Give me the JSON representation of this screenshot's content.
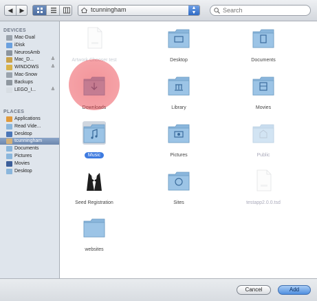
{
  "toolbar": {
    "back_glyph": "◀",
    "forward_glyph": "▶",
    "location": "tcunningham",
    "search_placeholder": "Search"
  },
  "sidebar": {
    "devices_header": "DEVICES",
    "places_header": "PLACES",
    "devices": [
      {
        "label": "Mac-Dual",
        "icon": "hard-drive-icon",
        "eject": false
      },
      {
        "label": "iDisk",
        "icon": "idisk-icon",
        "eject": false
      },
      {
        "label": "NeurosAmb",
        "icon": "network-drive-icon",
        "eject": false
      },
      {
        "label": "Mac_D...",
        "icon": "drive-icon",
        "eject": true
      },
      {
        "label": "WINDOWS",
        "icon": "windows-drive-icon",
        "eject": true
      },
      {
        "label": "Mac-Snow",
        "icon": "hard-drive-icon",
        "eject": false
      },
      {
        "label": "Backups",
        "icon": "backup-drive-icon",
        "eject": false
      },
      {
        "label": "LEGO_I...",
        "icon": "disc-icon",
        "eject": true
      }
    ],
    "places": [
      {
        "label": "Applications",
        "icon": "applications-icon"
      },
      {
        "label": "Read Vide...",
        "icon": "folder-icon"
      },
      {
        "label": "Desktop",
        "icon": "desktop-icon"
      },
      {
        "label": "tcunningham",
        "icon": "home-icon",
        "selected": true
      },
      {
        "label": "Documents",
        "icon": "documents-icon"
      },
      {
        "label": "Pictures",
        "icon": "pictures-icon"
      },
      {
        "label": "Movies",
        "icon": "movies-icon"
      },
      {
        "label": "Desktop",
        "icon": "desktop-folder-icon"
      }
    ],
    "eject_glyph": "≜"
  },
  "files": [
    {
      "name": "Artwork Chooser test",
      "kind": "document",
      "state": "ghost"
    },
    {
      "name": "Desktop",
      "kind": "desktop-folder",
      "state": "normal"
    },
    {
      "name": "Documents",
      "kind": "documents-folder",
      "state": "normal"
    },
    {
      "name": "Downloads",
      "kind": "downloads-folder",
      "state": "normal"
    },
    {
      "name": "Library",
      "kind": "library-folder",
      "state": "normal"
    },
    {
      "name": "Movies",
      "kind": "movies-folder",
      "state": "normal"
    },
    {
      "name": "Music",
      "kind": "music-folder",
      "state": "selected"
    },
    {
      "name": "Pictures",
      "kind": "pictures-folder",
      "state": "normal"
    },
    {
      "name": "Public",
      "kind": "public-folder",
      "state": "dim"
    },
    {
      "name": "Seed Registration",
      "kind": "tuxedo-app",
      "state": "normal"
    },
    {
      "name": "Sites",
      "kind": "sites-folder",
      "state": "normal"
    },
    {
      "name": "testapp2.0.0.tsd",
      "kind": "document",
      "state": "dim"
    },
    {
      "name": "websites",
      "kind": "folder",
      "state": "normal"
    }
  ],
  "buttons": {
    "cancel": "Cancel",
    "add": "Add"
  },
  "colors": {
    "folder": "#8ab6dc",
    "selection": "#3e7be0",
    "highlight": "#e63c46"
  }
}
